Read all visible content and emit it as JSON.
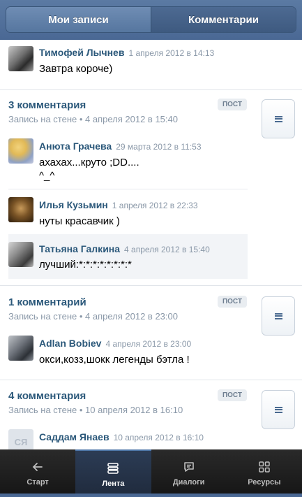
{
  "header": {
    "tab_my_posts": "Мои записи",
    "tab_comments": "Комментарии"
  },
  "first": {
    "name": "Тимофей Лычнев",
    "date": "1 апреля 2012 в 14:13",
    "text": "Завтра короче)"
  },
  "posts": [
    {
      "title": "3 комментария",
      "subtitle": "Запись на стене • 4 апреля 2012 в 15:40",
      "badge": "ПОСТ",
      "comments": [
        {
          "name": "Анюта Грачева",
          "date": "29 марта 2012 в 11:53",
          "text_line1": "ахахах...круто ;DD....",
          "text_line2": "^_^"
        },
        {
          "name": "Илья Кузьмин",
          "date": "1 апреля 2012 в 22:33",
          "text": "нуты красавчик )"
        },
        {
          "name": "Татьяна Галкина",
          "date": "4 апреля 2012 в 15:40",
          "text": "лучший:*:*:*:*:*:*:*:*"
        }
      ]
    },
    {
      "title": "1 комментарий",
      "subtitle": "Запись на стене • 4 апреля 2012 в 23:00",
      "badge": "ПОСТ",
      "comments": [
        {
          "name": "Adlan Bobiev",
          "date": "4 апреля 2012 в 23:00",
          "text": "окси,козз,шокк легенды бэтла !"
        }
      ]
    },
    {
      "title": "4 комментария",
      "subtitle": "Запись на стене • 10 апреля 2012 в 16:10",
      "badge": "ПОСТ",
      "comments": [
        {
          "name": "Саддам Янаев",
          "date": "10 апреля 2012 в 16:10",
          "avatar_initials": "СЯ"
        }
      ]
    }
  ],
  "tabbar": {
    "start": "Старт",
    "feed": "Лента",
    "dialogs": "Диалоги",
    "resources": "Ресурсы"
  },
  "colors": {
    "accent": "#2b587a",
    "header": "#4a6894",
    "tabbar": "#1a1a1a"
  }
}
